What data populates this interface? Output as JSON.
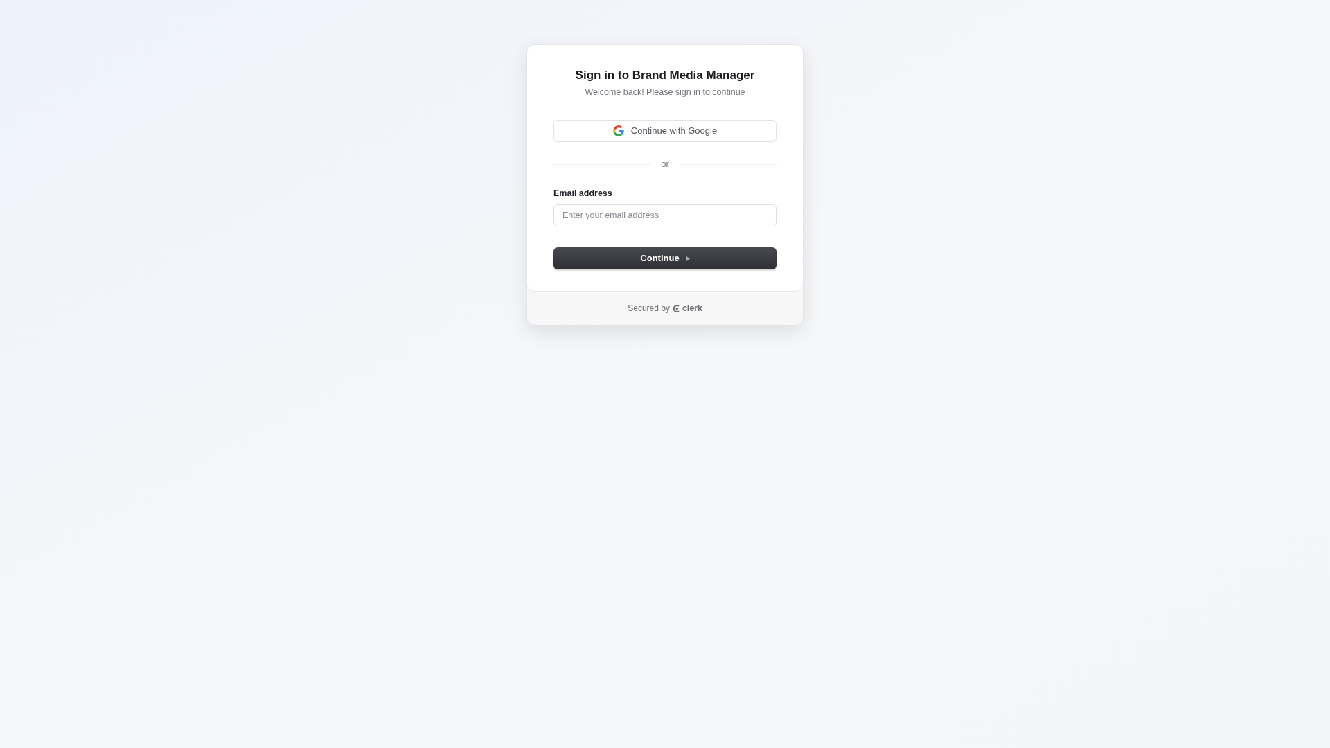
{
  "card": {
    "title": "Sign in to Brand Media Manager",
    "subtitle": "Welcome back! Please sign in to continue"
  },
  "social_button": {
    "label": "Continue with Google"
  },
  "divider": {
    "label": "or"
  },
  "email_field": {
    "label": "Email address",
    "placeholder": "Enter your email address"
  },
  "submit_button": {
    "label": "Continue"
  },
  "footer": {
    "text": "Secured by",
    "brand": "clerk"
  }
}
